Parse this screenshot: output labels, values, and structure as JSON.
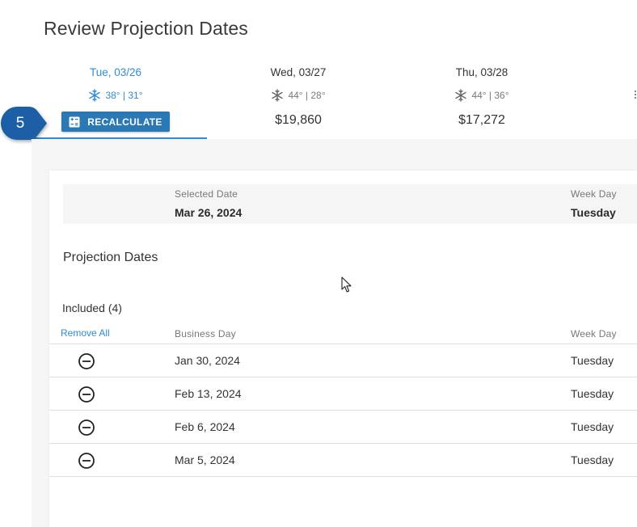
{
  "page": {
    "title": "Review Projection Dates"
  },
  "days": [
    {
      "label": "Tue, 03/26",
      "temps": "38° | 31°",
      "weather_icon": "snowflake-icon"
    },
    {
      "label": "Wed, 03/27",
      "temps": "44° | 28°",
      "weather_icon": "snowflake-icon",
      "amount": "$19,860"
    },
    {
      "label": "Thu, 03/28",
      "temps": "44° | 36°",
      "weather_icon": "snowflake-icon",
      "amount": "$17,272"
    }
  ],
  "recalculate": {
    "label": "RECALCULATE",
    "icon": "calculator-icon"
  },
  "step_badge": {
    "number": "5"
  },
  "selected": {
    "date_label": "Selected Date",
    "date_value": "Mar 26, 2024",
    "weekday_label": "Week Day",
    "weekday_value": "Tuesday"
  },
  "projection": {
    "title": "Projection Dates",
    "included_label": "Included (4)",
    "remove_all_label": "Remove All",
    "col_business_day": "Business Day",
    "col_week_day": "Week Day",
    "rows": [
      {
        "date": "Jan 30, 2024",
        "day": "Tuesday"
      },
      {
        "date": "Feb 13, 2024",
        "day": "Tuesday"
      },
      {
        "date": "Feb 6, 2024",
        "day": "Tuesday"
      },
      {
        "date": "Mar 5, 2024",
        "day": "Tuesday"
      }
    ]
  },
  "colors": {
    "accent": "#2f8bd3",
    "button": "#2a78b4",
    "badge": "#1d5fa6"
  }
}
